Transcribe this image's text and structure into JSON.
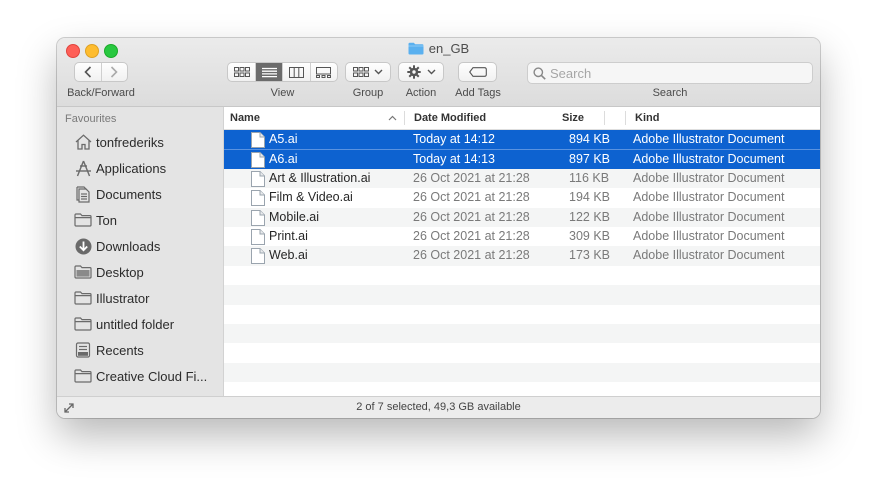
{
  "window": {
    "title": "en_GB"
  },
  "toolbar": {
    "back_forward_label": "Back/Forward",
    "view_label": "View",
    "group_label": "Group",
    "action_label": "Action",
    "add_tags_label": "Add Tags",
    "search_label": "Search",
    "search_placeholder": "Search"
  },
  "sidebar": {
    "heading": "Favourites",
    "items": [
      {
        "label": "tonfrederiks",
        "icon": "home-icon"
      },
      {
        "label": "Applications",
        "icon": "applications-icon"
      },
      {
        "label": "Documents",
        "icon": "document-icon"
      },
      {
        "label": "Ton",
        "icon": "folder-icon"
      },
      {
        "label": "Downloads",
        "icon": "download-icon"
      },
      {
        "label": "Desktop",
        "icon": "desktop-icon"
      },
      {
        "label": "Illustrator",
        "icon": "folder-icon"
      },
      {
        "label": "untitled folder",
        "icon": "folder-icon"
      },
      {
        "label": "Recents",
        "icon": "recents-icon"
      },
      {
        "label": "Creative Cloud Fi...",
        "icon": "folder-icon"
      }
    ]
  },
  "columns": {
    "name": "Name",
    "date": "Date Modified",
    "size": "Size",
    "kind": "Kind"
  },
  "files": [
    {
      "name": "A5.ai",
      "date": "Today at 14:12",
      "size": "894 KB",
      "kind": "Adobe Illustrator Document",
      "selected": true
    },
    {
      "name": "A6.ai",
      "date": "Today at 14:13",
      "size": "897 KB",
      "kind": "Adobe Illustrator Document",
      "selected": true
    },
    {
      "name": "Art & Illustration.ai",
      "date": "26 Oct 2021 at 21:28",
      "size": "116 KB",
      "kind": "Adobe Illustrator Document",
      "selected": false
    },
    {
      "name": "Film & Video.ai",
      "date": "26 Oct 2021 at 21:28",
      "size": "194 KB",
      "kind": "Adobe Illustrator Document",
      "selected": false
    },
    {
      "name": "Mobile.ai",
      "date": "26 Oct 2021 at 21:28",
      "size": "122 KB",
      "kind": "Adobe Illustrator Document",
      "selected": false
    },
    {
      "name": "Print.ai",
      "date": "26 Oct 2021 at 21:28",
      "size": "309 KB",
      "kind": "Adobe Illustrator Document",
      "selected": false
    },
    {
      "name": "Web.ai",
      "date": "26 Oct 2021 at 21:28",
      "size": "173 KB",
      "kind": "Adobe Illustrator Document",
      "selected": false
    }
  ],
  "status": {
    "text": "2 of 7 selected, 49,3 GB available"
  },
  "colors": {
    "selection": "#0d62d0",
    "folder": "#5ab0ef"
  }
}
